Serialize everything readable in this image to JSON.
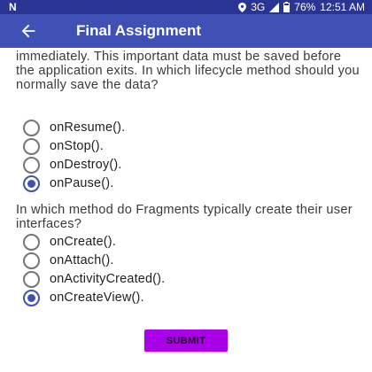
{
  "status_bar": {
    "logo": "N",
    "network": "3G",
    "battery": "76%",
    "time": "12:51 AM",
    "icons": [
      "notification-n-icon",
      "location-icon",
      "signal-icon",
      "battery-icon"
    ]
  },
  "app_bar": {
    "title": "Final Assignment",
    "back_icon": "arrow-back-icon"
  },
  "questions": [
    {
      "text": "Such as the user's account name, but does not save it immediately. This important data must be saved before the application exits. In which lifecycle method should you normally save the data?",
      "options": [
        "onResume().",
        "onStop().",
        "onDestroy().",
        "onPause()."
      ],
      "selected": 3
    },
    {
      "text": "In which method do Fragments typically create their user interfaces?",
      "options": [
        "onCreate().",
        "onAttach().",
        "onActivityCreated().",
        "onCreateView()."
      ],
      "selected": 3
    }
  ],
  "submit_label": "SUBMIT",
  "colors": {
    "status_bar": "#2a3593",
    "app_bar": "#3f51b5",
    "radio_accent": "#3f51b5",
    "submit_button": "#aa00e8"
  }
}
